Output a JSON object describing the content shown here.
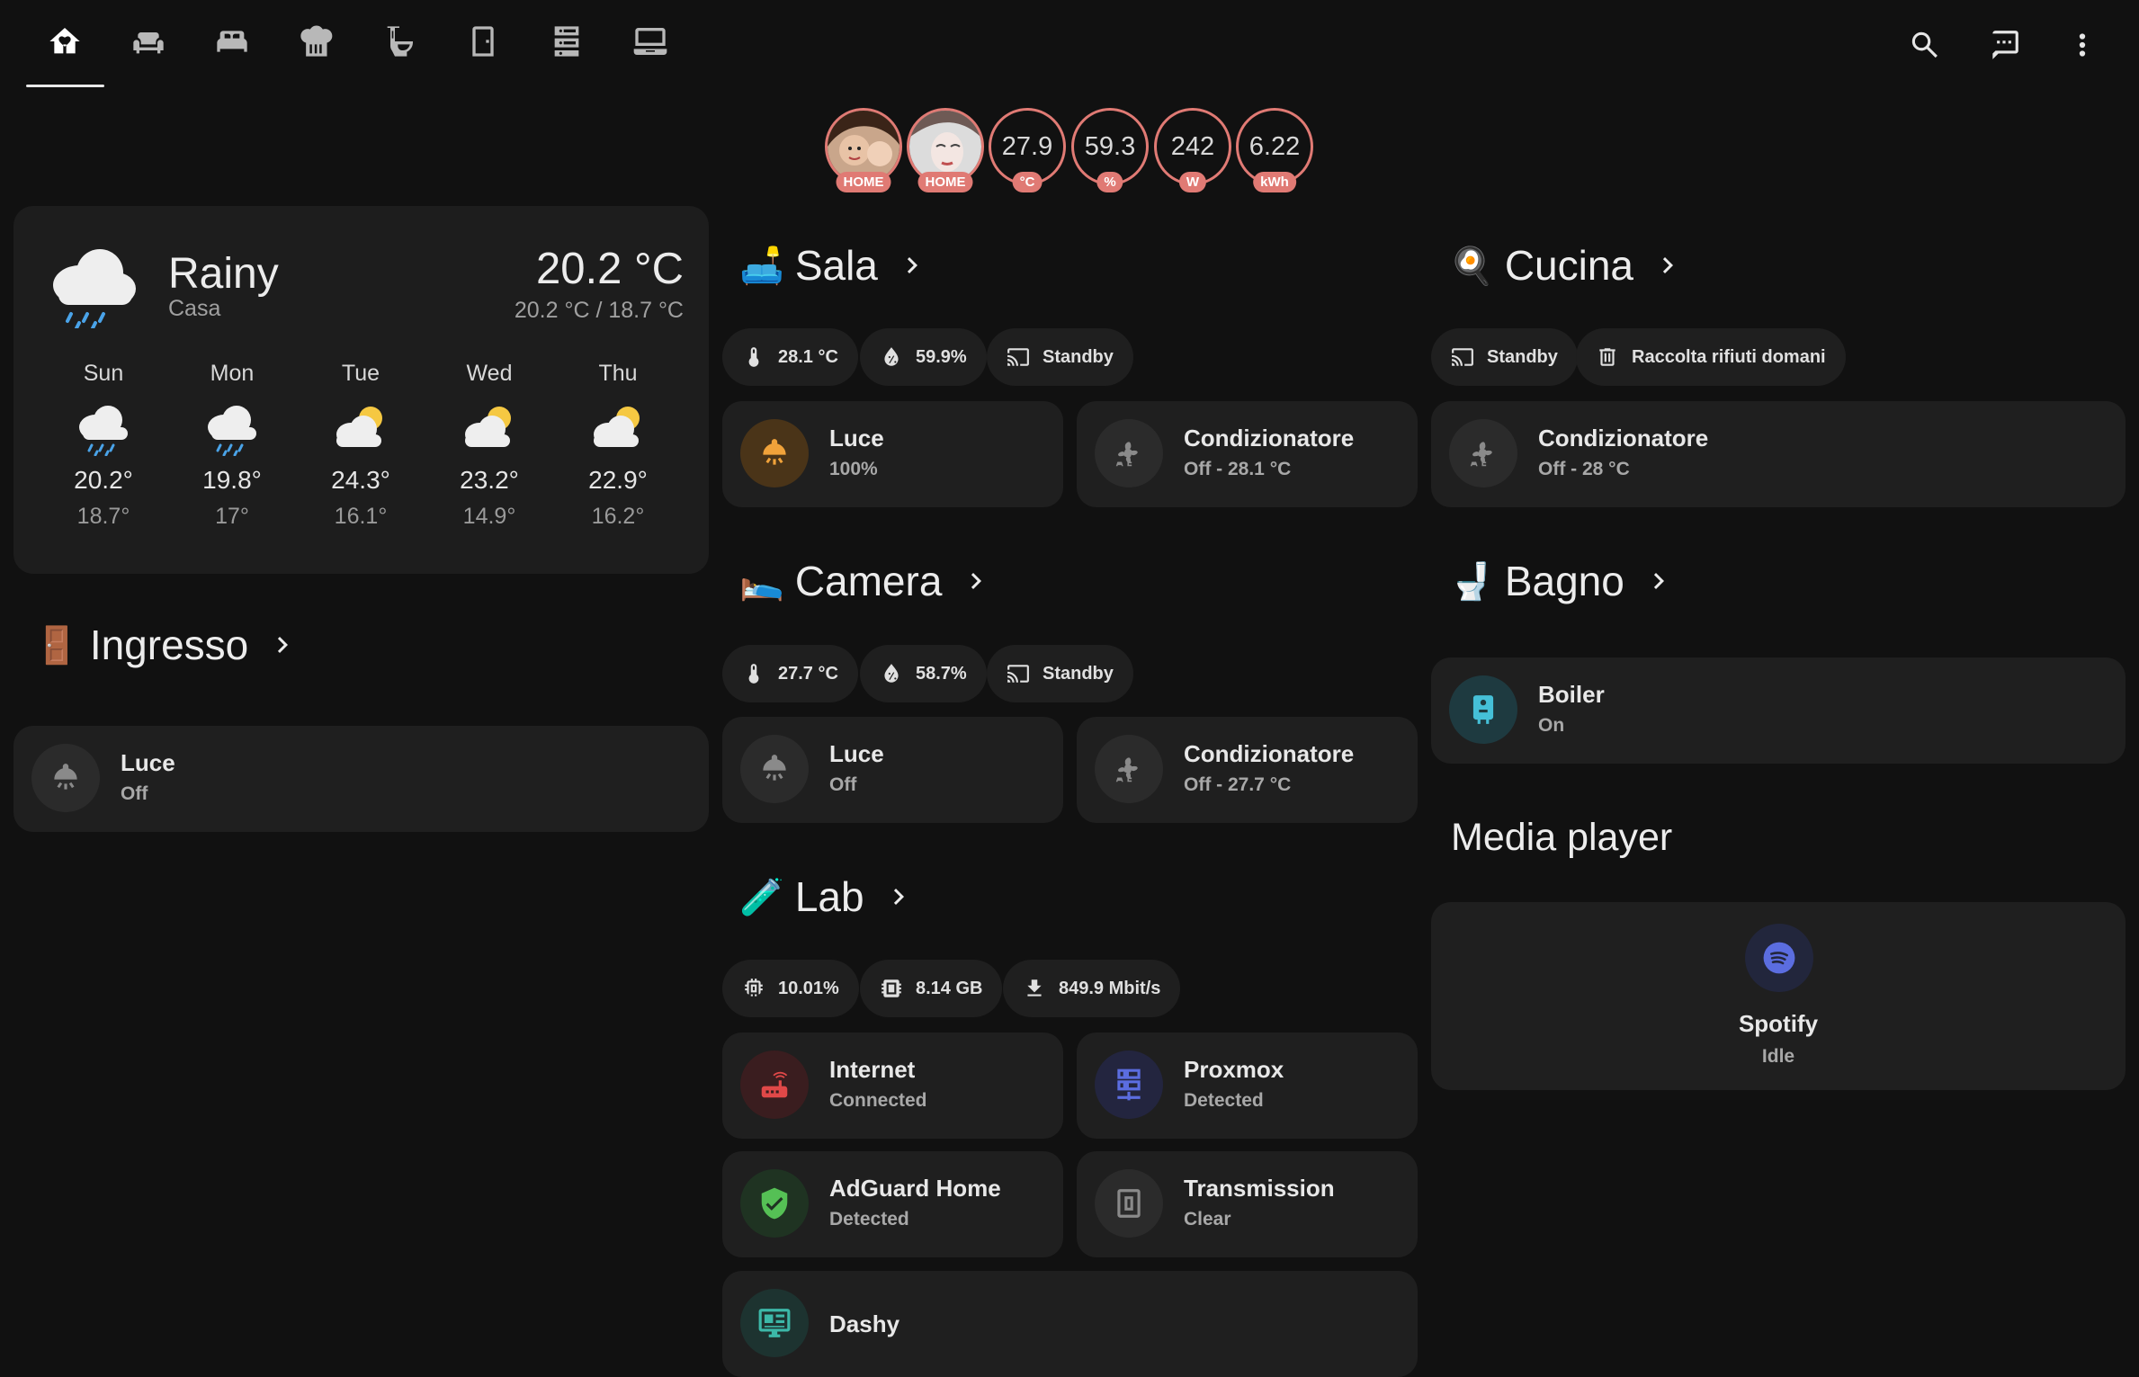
{
  "header": {
    "tabs": [
      {
        "icon": "home-heart-icon",
        "active": true
      },
      {
        "icon": "sofa-icon"
      },
      {
        "icon": "bed-icon"
      },
      {
        "icon": "chef-hat-icon"
      },
      {
        "icon": "toilet-icon"
      },
      {
        "icon": "door-icon"
      },
      {
        "icon": "server-icon"
      },
      {
        "icon": "laptop-icon"
      }
    ],
    "actions": [
      "search-icon",
      "message-icon",
      "menu-icon"
    ]
  },
  "badges": [
    {
      "type": "person",
      "label": "HOME"
    },
    {
      "type": "person",
      "label": "HOME"
    },
    {
      "value": "27.9",
      "unit": "°C"
    },
    {
      "value": "59.3",
      "unit": "%"
    },
    {
      "value": "242",
      "unit": "W"
    },
    {
      "value": "6.22",
      "unit": "kWh"
    }
  ],
  "weather": {
    "condition": "Rainy",
    "location": "Casa",
    "temperature": "20.2 °C",
    "high_low": "20.2 °C / 18.7 °C",
    "forecast": [
      {
        "day": "Sun",
        "icon": "rainy-icon",
        "high": "20.2°",
        "low": "18.7°"
      },
      {
        "day": "Mon",
        "icon": "rainy-icon",
        "high": "19.8°",
        "low": "17°"
      },
      {
        "day": "Tue",
        "icon": "partly-cloudy-icon",
        "high": "24.3°",
        "low": "16.1°"
      },
      {
        "day": "Wed",
        "icon": "partly-cloudy-icon",
        "high": "23.2°",
        "low": "14.9°"
      },
      {
        "day": "Thu",
        "icon": "partly-cloudy-icon",
        "high": "22.9°",
        "low": "16.2°"
      }
    ]
  },
  "rooms": {
    "ingresso": {
      "title": "Ingresso",
      "emoji": "🚪",
      "tiles": [
        {
          "name": "Luce",
          "state": "Off"
        }
      ]
    },
    "sala": {
      "title": "Sala",
      "emoji": "🛋️",
      "chips": [
        "28.1 °C",
        "59.9%",
        "Standby"
      ],
      "tiles": [
        {
          "name": "Luce",
          "state": "100%"
        },
        {
          "name": "Condizionatore",
          "state": "Off - 28.1 °C"
        }
      ]
    },
    "camera": {
      "title": "Camera",
      "emoji": "🛌",
      "chips": [
        "27.7 °C",
        "58.7%",
        "Standby"
      ],
      "tiles": [
        {
          "name": "Luce",
          "state": "Off"
        },
        {
          "name": "Condizionatore",
          "state": "Off - 27.7 °C"
        }
      ]
    },
    "lab": {
      "title": "Lab",
      "emoji": "🧪",
      "chips": [
        "10.01%",
        "8.14 GB",
        "849.9 Mbit/s"
      ],
      "tiles": [
        {
          "name": "Internet",
          "state": "Connected"
        },
        {
          "name": "Proxmox",
          "state": "Detected"
        },
        {
          "name": "AdGuard Home",
          "state": "Detected"
        },
        {
          "name": "Transmission",
          "state": "Clear"
        },
        {
          "name": "Dashy",
          "state": ""
        }
      ]
    },
    "cucina": {
      "title": "Cucina",
      "emoji": "🍳",
      "chips": [
        "Standby",
        "Raccolta rifiuti domani"
      ],
      "tiles": [
        {
          "name": "Condizionatore",
          "state": "Off - 28 °C"
        }
      ]
    },
    "bagno": {
      "title": "Bagno",
      "emoji": "🚽",
      "tiles": [
        {
          "name": "Boiler",
          "state": "On"
        }
      ]
    }
  },
  "media": {
    "title": "Media player",
    "player": {
      "name": "Spotify",
      "state": "Idle",
      "icon": "spotify-icon"
    }
  },
  "colors": {
    "background": "#111111",
    "card": "#1d1d1d",
    "badge_ring": "#e07a74",
    "light_on": "#f0a23a"
  }
}
